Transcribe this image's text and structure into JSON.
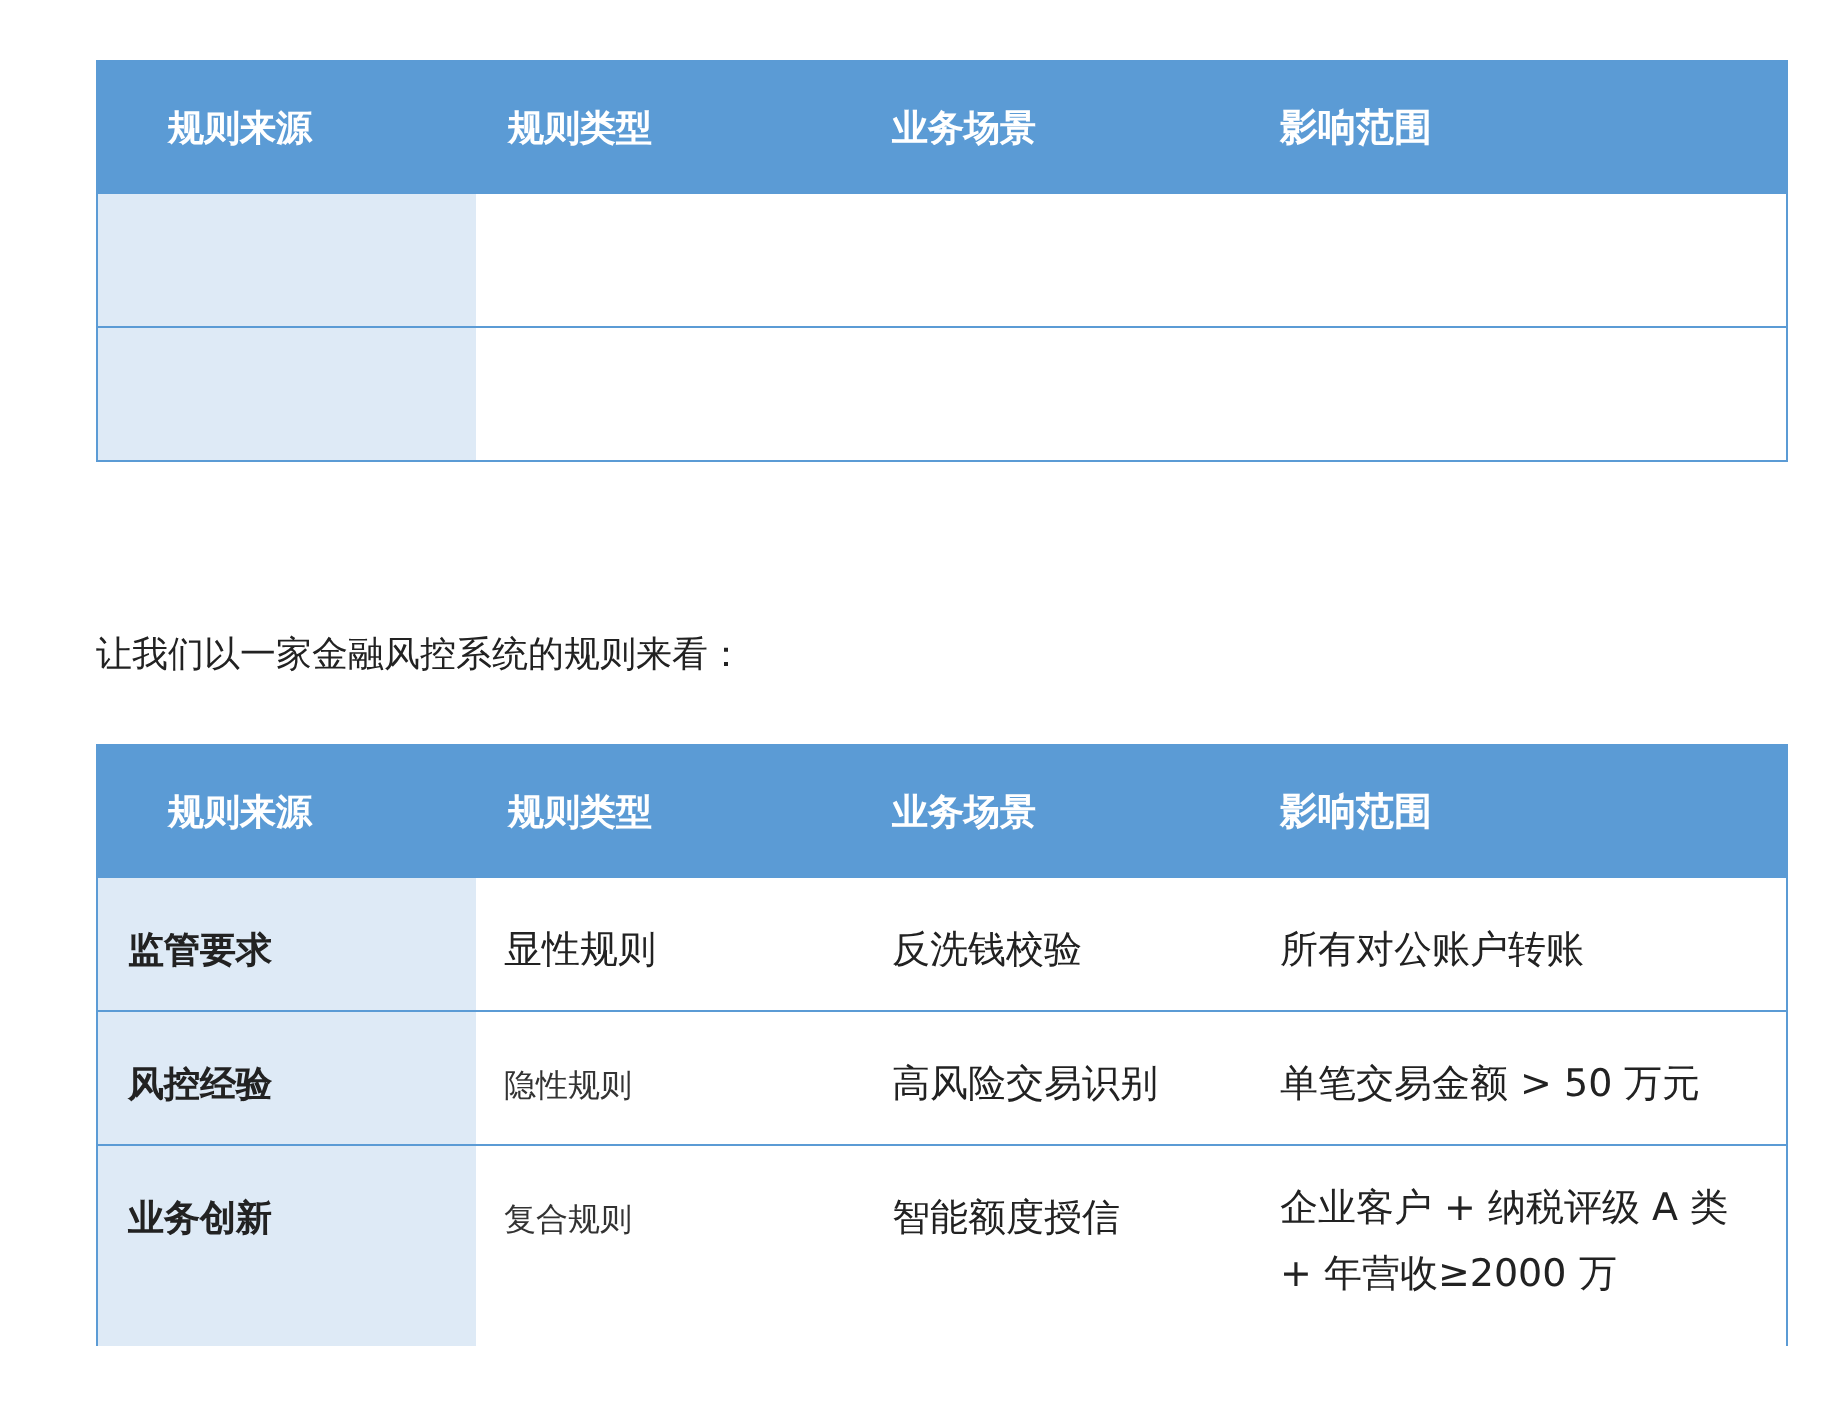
{
  "top_table": {
    "columns": [
      "规则来源",
      "规则类型",
      "业务场景",
      "影响范围"
    ]
  },
  "intro": "让我们以一家金融风控系统的规则来看：",
  "rules_table": {
    "columns": [
      "规则来源",
      "规则类型",
      "业务场景",
      "影响范围"
    ],
    "rows": [
      [
        "监管要求",
        "显性规则",
        "反洗钱校验",
        "所有对公账户转账"
      ],
      [
        "风控经验",
        "隐性规则",
        "高风险交易识别",
        "单笔交易金额 > 50 万元"
      ],
      [
        "业务创新",
        "复合规则",
        "智能额度授信",
        "企业客户 + 纳税评级 A 类 + 年营收≥2000 万"
      ]
    ]
  }
}
